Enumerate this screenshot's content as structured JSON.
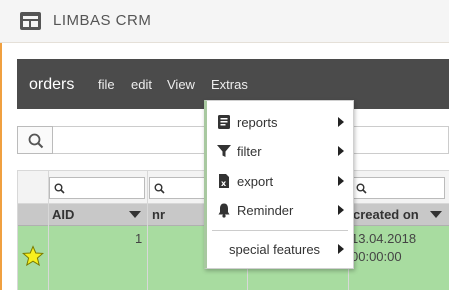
{
  "app": {
    "title": "LIMBAS CRM"
  },
  "toolbar": {
    "title": "orders",
    "menu": [
      "file",
      "edit",
      "View",
      "Extras"
    ]
  },
  "table": {
    "columns": [
      "AID",
      "nr",
      "",
      "created on"
    ],
    "rows": [
      {
        "favorite": true,
        "aid": "1",
        "nr": "",
        "col3": "",
        "created_on_date": "13.04.2018",
        "created_on_time": "00:00:00"
      }
    ]
  },
  "extras_menu": {
    "items": [
      {
        "label": "reports",
        "icon": "report-icon",
        "submenu": true
      },
      {
        "label": "filter",
        "icon": "filter-icon",
        "submenu": true
      },
      {
        "label": "export",
        "icon": "excel-export-icon",
        "submenu": true
      },
      {
        "label": "Reminder",
        "icon": "bell-icon",
        "submenu": true
      },
      {
        "label": "special features",
        "icon": "",
        "submenu": true
      }
    ]
  },
  "colors": {
    "toolbar_bg": "#4b4b4b",
    "row_highlight": "#a8dca0",
    "header_bg": "#c8c8c8",
    "accent_line": "#f0a040"
  }
}
